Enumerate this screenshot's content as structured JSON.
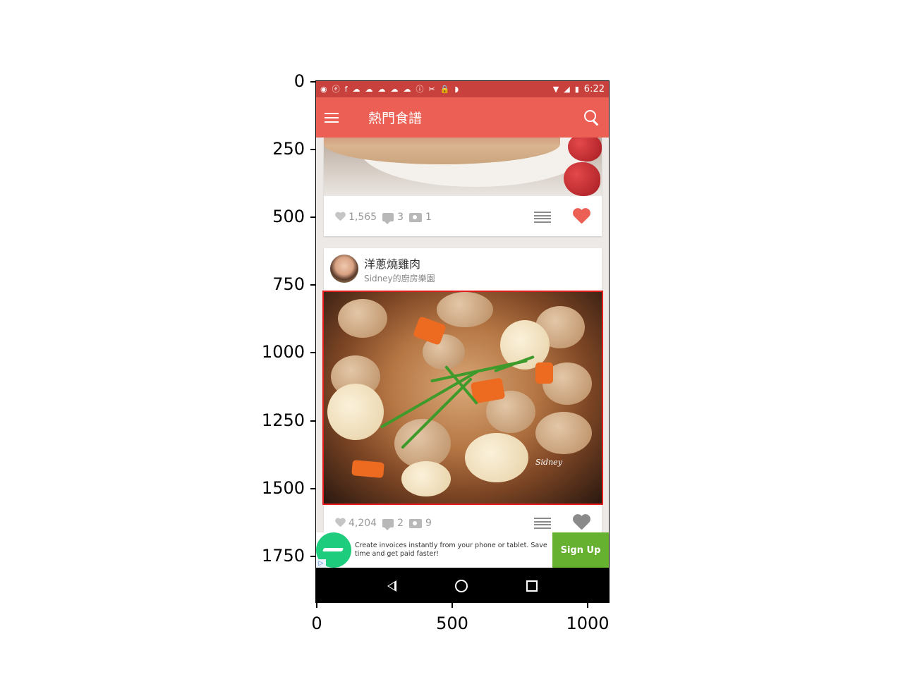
{
  "axes": {
    "yticks": [
      "0",
      "250",
      "500",
      "750",
      "1000",
      "1250",
      "1500",
      "1750"
    ],
    "xticks": [
      "0",
      "500",
      "1000"
    ]
  },
  "statusbar": {
    "time": "6:22"
  },
  "appbar": {
    "title": "熱門食譜"
  },
  "recipes": [
    {
      "likes": "1,565",
      "comments": "3",
      "photos": "1",
      "favorited": true
    },
    {
      "title": "洋蔥燒雞肉",
      "author": "Sidney的廚房樂園",
      "watermark": "Sidney",
      "likes": "4,204",
      "comments": "2",
      "photos": "9",
      "favorited": false
    }
  ],
  "ad": {
    "text": "Create invoices instantly from your phone or tablet. Save time and get paid faster!",
    "button": "Sign Up"
  },
  "colors": {
    "primary": "#ec5f55",
    "status_bar": "#c9413c",
    "highlight": "#e11d1d",
    "ad_button": "#67b131"
  }
}
